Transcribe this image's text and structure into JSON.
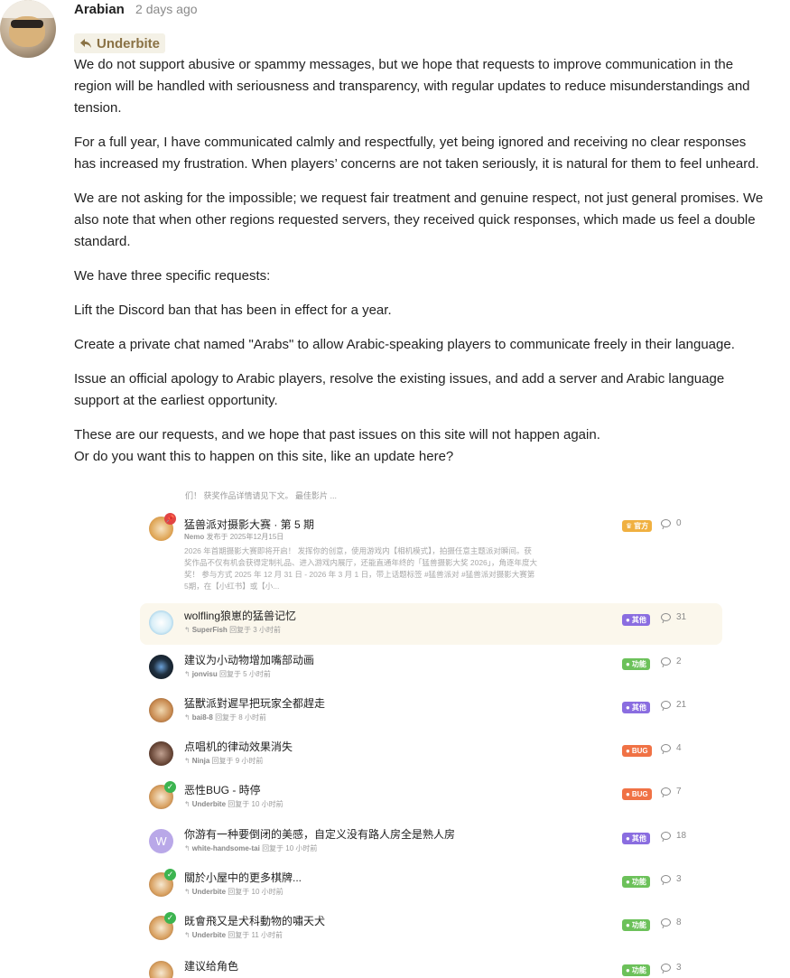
{
  "post": {
    "username": "Arabian",
    "time": "2 days ago",
    "reply_to": "Underbite",
    "paragraphs": [
      "We do not support abusive or spammy messages, but we hope that requests to improve communication in the region will be handled with seriousness and transparency, with regular updates to reduce misunderstandings and tension.",
      "For a full year, I have communicated calmly and respectfully, yet being ignored and receiving no clear responses has increased my frustration. When players’ concerns are not taken seriously, it is natural for them to feel unheard.",
      "We are not asking for the impossible; we request fair treatment and genuine respect, not just general promises. We also note that when other regions requested servers, they received quick responses, which made us feel a double standard.",
      "We have three specific requests:",
      "Lift the Discord ban that has been in effect for a year.",
      "Create a private chat named \"Arabs\" to allow Arabic-speaking players to communicate freely in their language.",
      "Issue an official apology to Arabic players, resolve the existing issues, and add a server and Arabic language support at the earliest opportunity."
    ],
    "closing_1": "These are our requests, and we hope that past issues on this site will not happen again.",
    "closing_2": "Or do you want this to happen on this site, like an update here?"
  },
  "embed": {
    "fade_top": "们！ 获奖作品详情请见下文。 最佳影片 ...",
    "pinned": {
      "title": "猛兽派对摄影大赛 · 第 5 期",
      "author": "Nemo",
      "meta": "发布于 2025年12月15日",
      "excerpt": "2026 年首期摄影大赛即将开启！ 发挥你的创意，使用游戏内【相机模式】，拍摄任意主题派对瞬间。获奖作品不仅有机会获得定制礼品、进入游戏内展厅，还能直通年终的「猛兽摄影大奖 2026」，角逐年度大奖！ 参与方式 2025 年 12 月 31 日 - 2026 年 3 月 1 日，带上话题标签 #猛兽派对 #猛兽派对摄影大赛第5期，在【小红书】或【小...",
      "badge": "官方",
      "replies": "0"
    },
    "topics": [
      {
        "title": "wolfling狼崽的猛兽记忆",
        "user": "SuperFish",
        "meta": "回复于 3 小时前",
        "badge": "其他",
        "replies": "31"
      },
      {
        "title": "建议为小动物增加嘴部动画",
        "user": "jonvisu",
        "meta": "回复于 5 小时前",
        "badge": "功能",
        "replies": "2"
      },
      {
        "title": "猛獸派對遲早把玩家全都趕走",
        "user": "bai8-8",
        "meta": "回复于 8 小时前",
        "badge": "其他",
        "replies": "21"
      },
      {
        "title": "点唱机的律动效果消失",
        "user": "Ninja",
        "meta": "回复于 9 小时前",
        "badge": "BUG",
        "replies": "4"
      },
      {
        "title": "恶性BUG - 時停",
        "user": "Underbite",
        "meta": "回复于 10 小时前",
        "badge": "BUG",
        "replies": "7"
      },
      {
        "title": "你游有一种要倒闭的美感，自定义没有路人房全是熟人房",
        "user": "white-handsome-tai",
        "meta": "回复于 10 小时前",
        "badge": "其他",
        "replies": "18"
      },
      {
        "title": "關於小屋中的更多棋牌...",
        "user": "Underbite",
        "meta": "回复于 10 小时前",
        "badge": "功能",
        "replies": "3"
      },
      {
        "title": "既會飛又是犬科動物的嘯天犬",
        "user": "Underbite",
        "meta": "回复于 11 小时前",
        "badge": "功能",
        "replies": "8"
      },
      {
        "title": "建议给角色",
        "user": "",
        "meta": "",
        "badge": "功能",
        "replies": "3"
      }
    ],
    "avatar_letter": "W"
  },
  "colors": {
    "badge_official": "#f0b040",
    "badge_other": "#8a6de0",
    "badge_feature": "#6cc15a",
    "badge_bug": "#f07245"
  }
}
